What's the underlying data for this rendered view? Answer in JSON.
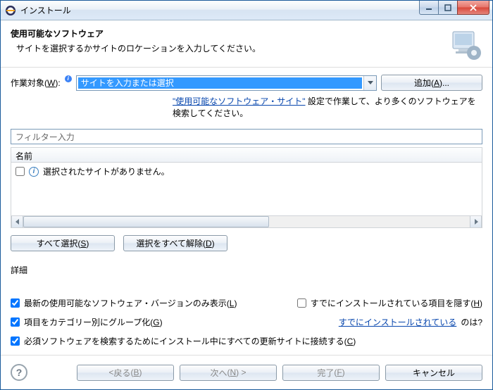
{
  "titlebar": {
    "title": "インストール"
  },
  "header": {
    "title": "使用可能なソフトウェア",
    "subtitle": "サイトを選択するかサイトのロケーションを入力してください。"
  },
  "workWith": {
    "labelPrefix": "作業対象",
    "labelKey": "W",
    "value": "サイトを入力または選択",
    "addPrefix": "追加",
    "addKey": "A"
  },
  "sitesHint": {
    "link": "\"使用可能なソフトウェア・サイト\"",
    "suffix": " 設定で作業して、より多くのソフトウェアを検索してください。"
  },
  "filter": {
    "placeholder": "フィルター入力"
  },
  "tree": {
    "column": "名前",
    "emptyMessage": "選択されたサイトがありません。"
  },
  "buttons": {
    "selectAllPrefix": "すべて選択",
    "selectAllKey": "S",
    "deselectAllPrefix": "選択をすべて解除",
    "deselectAllKey": "D"
  },
  "details": {
    "label": "詳細"
  },
  "options": {
    "showLatest": {
      "prefix": "最新の使用可能なソフトウェア・バージョンのみ表示",
      "key": "L",
      "checked": true
    },
    "hideInstalled": {
      "prefix": "すでにインストールされている項目を隠す",
      "key": "H",
      "checked": false
    },
    "groupByCategory": {
      "prefix": "項目をカテゴリー別にグループ化",
      "key": "G",
      "checked": true
    },
    "alreadyInstalled": {
      "link": "すでにインストールされている",
      "suffix": " のは?"
    },
    "contactSites": {
      "prefix": "必須ソフトウェアを検索するためにインストール中にすべての更新サイトに接続する",
      "key": "C",
      "checked": true
    }
  },
  "footer": {
    "backPrefix": "戻る",
    "backKey": "B",
    "nextPrefix": "次へ",
    "nextKey": "N",
    "finishPrefix": "完了",
    "finishKey": "F",
    "cancel": "キャンセル"
  }
}
